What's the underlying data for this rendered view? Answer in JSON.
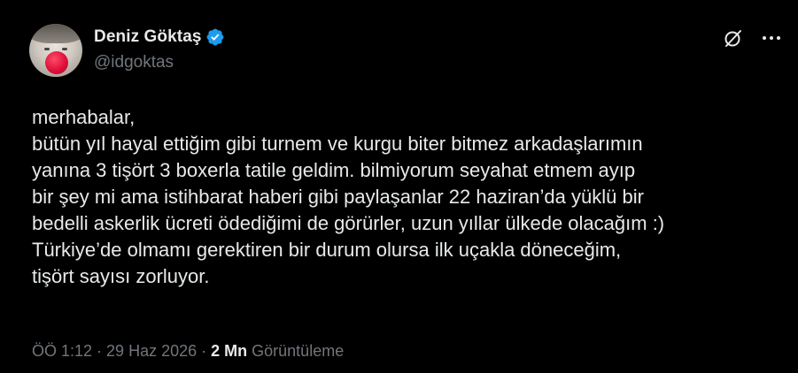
{
  "author": {
    "display_name": "Deniz Göktaş",
    "handle": "@idgoktas",
    "verified": true,
    "avatar_icon": "avatar"
  },
  "actions": {
    "grok_icon": "grok-icon",
    "more_icon": "more-icon"
  },
  "tweet": {
    "lines": [
      "merhabalar,",
      "bütün yıl hayal ettiğim gibi turnem ve kurgu biter bitmez arkadaşlarımın",
      "yanına 3 tişört 3 boxerla tatile geldim. bilmiyorum seyahat etmem ayıp",
      "bir şey mi ama istihbarat haberi gibi paylaşanlar 22 haziran’da yüklü bir",
      "bedelli askerlik ücreti ödediğimi de görürler, uzun yıllar ülkede olacağım :)",
      "Türkiye’de olmamı gerektiren bir durum olursa ilk uçakla döneceğim,",
      "tişört sayısı zorluyor."
    ]
  },
  "meta": {
    "time": "ÖÖ 1:12",
    "date": "29 Haz 2026",
    "separator": " · ",
    "views_count": "2 Mn",
    "views_label": "Görüntüleme"
  },
  "colors": {
    "background": "#000000",
    "text_primary": "#e7e9ea",
    "text_secondary": "#71767b",
    "verified_blue": "#1d9bf0"
  }
}
